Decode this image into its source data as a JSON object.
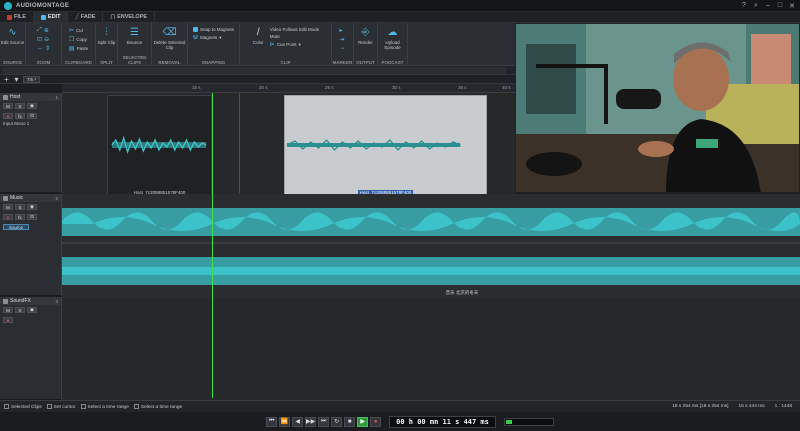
{
  "app": {
    "title": "AUDIOMONTAGE"
  },
  "tabs": [
    {
      "label": "FILE",
      "color": "#c2402f"
    },
    {
      "label": "EDIT",
      "color": "#4fb8e8",
      "active": true
    },
    {
      "label": "FADE",
      "color": "#8a8f96"
    },
    {
      "label": "ENVELOPE",
      "color": "#8a8f96"
    }
  ],
  "ribbon": {
    "source": {
      "group": "SOURCE",
      "edit_source": "Edit Source"
    },
    "zoom": {
      "group": "ZOOM"
    },
    "clipboard": {
      "group": "CLIPBOARD",
      "cut": "Cut",
      "copy": "Copy",
      "paste": "Paste"
    },
    "split": {
      "group": "SPLIT",
      "split_clip": "Split Clip"
    },
    "selected_clips": {
      "group": "SELECTED CLIPS",
      "bounce": "Bounce"
    },
    "removal": {
      "group": "REMOVAL",
      "delete": "Delete Selected Clip"
    },
    "snapping": {
      "group": "SNAPPING",
      "snap_to_magnets": "Snap to Magnets",
      "magnets": "Magnets"
    },
    "clip": {
      "group": "CLIP",
      "color": "Color",
      "video_follows": "Video Follows Edit Mode",
      "mute": "Mute",
      "cue_point": "Cue Point"
    },
    "marker": {
      "group": "MARKER"
    },
    "output": {
      "group": "OUTPUT",
      "render": "Render"
    },
    "podcast": {
      "group": "PODCAST",
      "upload": "Upload Episode"
    }
  },
  "toolbar3": {
    "track_selector": "Trk *"
  },
  "ruler": {
    "ticks": [
      "15 s",
      "20 s",
      "25 s",
      "30 s",
      "35 s",
      "40 s"
    ]
  },
  "tracks": [
    {
      "name": "Host",
      "number": "1",
      "m": "M",
      "s": "S",
      "sub": "Input Mono 1"
    },
    {
      "name": "Music",
      "number": "2",
      "m": "M",
      "s": "S",
      "source": "Source"
    },
    {
      "name": "SoundFX",
      "number": "3",
      "m": "M",
      "s": "S"
    }
  ],
  "clips": {
    "host_a": "Host_7c2088851578F400",
    "host_b": "Host_7c2088851578F400",
    "music": "音乐 北京的冬天"
  },
  "statusbar": {
    "selected_clips": "Selected Clips",
    "set_cursor": "Set cursor",
    "select_time_range_1": "Select a time range",
    "select_time_range_2": "Select a time range",
    "left_readout": "18 s 254 ms  [18 s 254 ms]",
    "right_readout": "15 s 444 ms",
    "zoom": "1 : 1448"
  },
  "transport": {
    "timecode": "00 h 00 mn 11 s 447 ms"
  },
  "colors": {
    "accent": "#4fb8e8",
    "wave": "#3cc3c9",
    "playhead": "#3ee04e"
  }
}
